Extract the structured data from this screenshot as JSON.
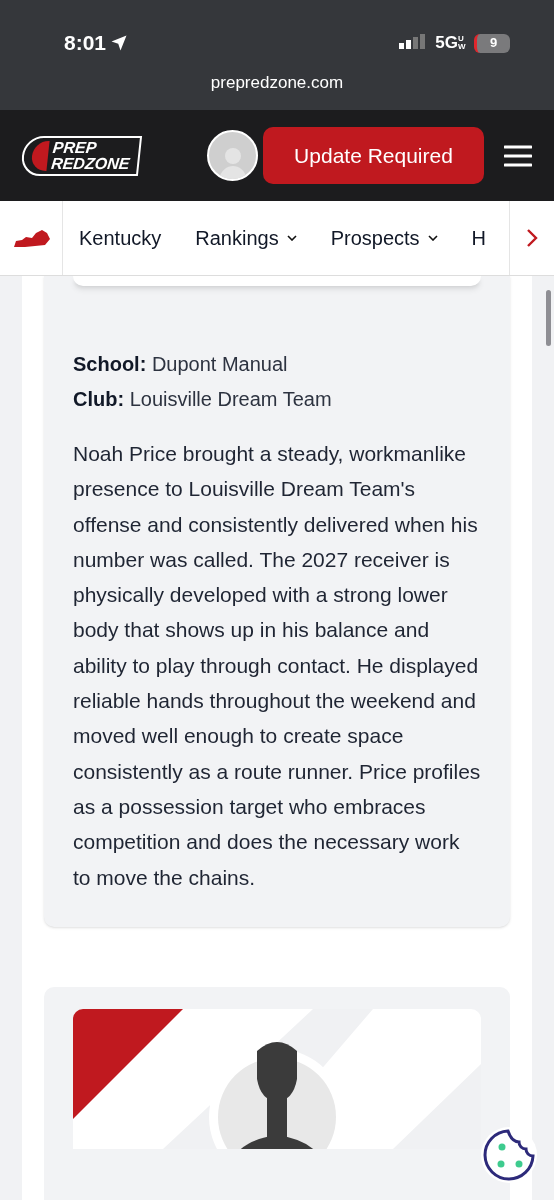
{
  "status_bar": {
    "time": "8:01",
    "network": "5G",
    "network_sub": "UW",
    "battery": "9"
  },
  "browser": {
    "url": "prepredzone.com"
  },
  "header": {
    "logo": [
      "PREP",
      "REDZONE"
    ],
    "update_button": "Update Required"
  },
  "nav": {
    "items": [
      {
        "label": "Kentucky",
        "dropdown": false
      },
      {
        "label": "Rankings",
        "dropdown": true
      },
      {
        "label": "Prospects",
        "dropdown": true
      },
      {
        "label": "H",
        "dropdown": false
      }
    ]
  },
  "profile": {
    "fields": [
      {
        "label": "School:",
        "value": "Dupont Manual"
      },
      {
        "label": "Club:",
        "value": "Louisville Dream Team"
      }
    ],
    "bio": "Noah Price brought a steady, workmanlike presence to Louisville Dream Team's offense and consistently delivered when his number was called. The 2027 receiver is physically developed with a strong lower body that shows up in his balance and ability to play through contact. He displayed reliable hands throughout the weekend and moved well enough to create space consistently as a route runner. Price profiles as a possession target who embraces competition and does the necessary work to move the chains."
  }
}
